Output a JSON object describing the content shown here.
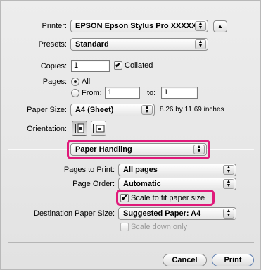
{
  "printer": {
    "label": "Printer:",
    "value": "EPSON Epson Stylus Pro XXXXX",
    "disclosure_icon": "triangle-up"
  },
  "presets": {
    "label": "Presets:",
    "value": "Standard"
  },
  "copies": {
    "label": "Copies:",
    "value": "1",
    "collated_label": "Collated",
    "collated_checked": true
  },
  "pages": {
    "label": "Pages:",
    "all_label": "All",
    "from_label": "From:",
    "from_value": "1",
    "to_label": "to:",
    "to_value": "1"
  },
  "paper_size": {
    "label": "Paper Size:",
    "value": "A4 (Sheet)",
    "dims": "8.26 by 11.69 inches"
  },
  "orientation": {
    "label": "Orientation:"
  },
  "panel": {
    "value": "Paper Handling"
  },
  "pages_to_print": {
    "label": "Pages to Print:",
    "value": "All pages"
  },
  "page_order": {
    "label": "Page Order:",
    "value": "Automatic"
  },
  "scale_fit": {
    "label": "Scale to fit paper size",
    "checked": true
  },
  "destination": {
    "label": "Destination Paper Size:",
    "value": "Suggested Paper: A4"
  },
  "scale_down": {
    "label": "Scale down only",
    "checked": false
  },
  "buttons": {
    "cancel": "Cancel",
    "print": "Print"
  },
  "colors": {
    "highlight": "#e0197a"
  }
}
